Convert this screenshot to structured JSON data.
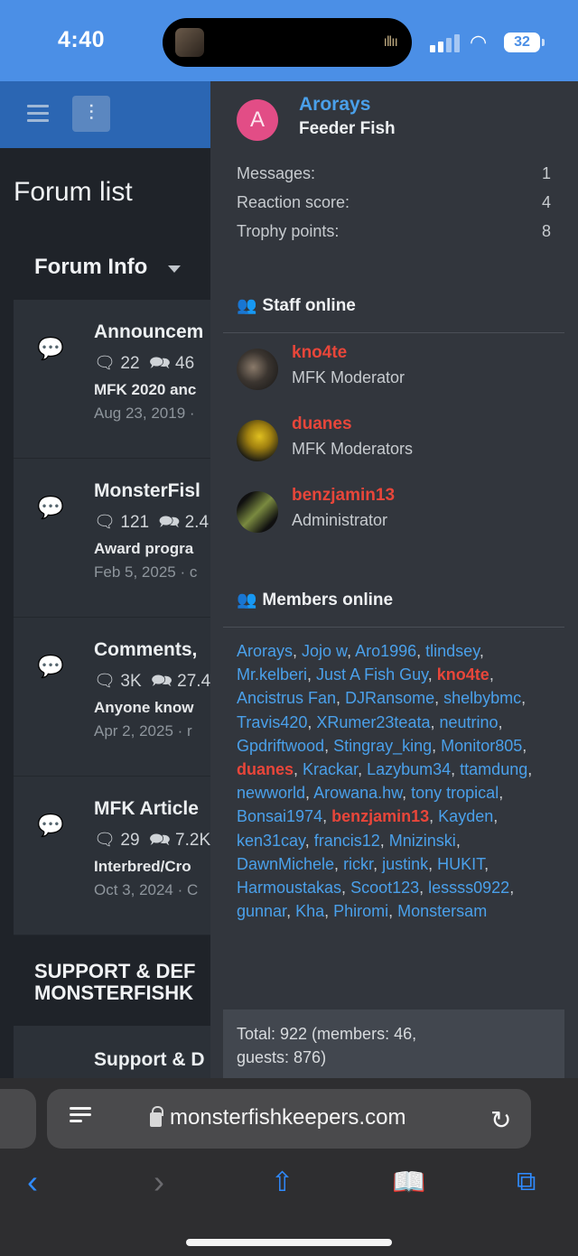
{
  "status_bar": {
    "time": "4:40",
    "battery": "32"
  },
  "forum": {
    "page_title": "Forum list",
    "category": "Forum Info",
    "nodes": [
      {
        "title": "Announcem",
        "threads": "22",
        "messages": "46",
        "latest": "MFK 2020 anc",
        "date": "Aug 23, 2019 ·"
      },
      {
        "title": "MonsterFisl",
        "threads": "121",
        "messages": "2.4",
        "latest": "Award progra",
        "date": "Feb 5, 2025 · c"
      },
      {
        "title": "Comments,",
        "threads": "3K",
        "messages": "27.4",
        "latest": "Anyone know",
        "date": "Apr 2, 2025 · r"
      },
      {
        "title": "MFK Article",
        "threads": "29",
        "messages": "7.2K",
        "latest": "Interbred/Cro",
        "date": "Oct 3, 2024 · C"
      }
    ],
    "category2_line1": "SUPPORT & DEF",
    "category2_line2": "MONSTERFISHK",
    "last_node_title": "Support & D"
  },
  "panel": {
    "user": {
      "avatar_letter": "A",
      "name": "Arorays",
      "title": "Feeder Fish"
    },
    "stats": [
      {
        "label": "Messages:",
        "value": "1"
      },
      {
        "label": "Reaction score:",
        "value": "4"
      },
      {
        "label": "Trophy points:",
        "value": "8"
      }
    ],
    "staff_heading": "Staff online",
    "staff": [
      {
        "name": "kno4te",
        "role": "MFK Moderator"
      },
      {
        "name": "duanes",
        "role": "MFK Moderators"
      },
      {
        "name": "benzjamin13",
        "role": "Administrator"
      }
    ],
    "members_heading": "Members online",
    "members": [
      "Arorays",
      "Jojo w",
      "Aro1996",
      "tlindsey",
      "Mr.kelberi",
      "Just A Fish Guy",
      "kno4te",
      "Ancistrus Fan",
      "DJRansome",
      "shelbybmc",
      "Travis420",
      "XRumer23teata",
      "neutrino",
      "Gpdriftwood",
      "Stingray_king",
      "Monitor805",
      "duanes",
      "Krackar",
      "Lazybum34",
      "ttamdung",
      "newworld",
      "Arowana.hw",
      "tony tropical",
      "Bonsai1974",
      "benzjamin13",
      "Kayden",
      "ken31cay",
      "francis12",
      "Mnizinski",
      "DawnMichele",
      "rickr",
      "justink",
      "HUKIT",
      "Harmoustakas",
      "Scoot123",
      "lessss0922",
      "gunnar",
      "Kha",
      "Phiromi",
      "Monstersam"
    ],
    "staff_members": [
      "kno4te",
      "duanes",
      "benzjamin13"
    ],
    "totals_line1": "Total: 922 (members: 46,",
    "totals_line2": "guests: 876)"
  },
  "browser": {
    "url": "monsterfishkeepers.com"
  },
  "colors": {
    "accent": "#4aa0ea",
    "staff": "#e8463a",
    "unread_icon": "#7cb342",
    "status_bar": "#4b8fe6"
  }
}
